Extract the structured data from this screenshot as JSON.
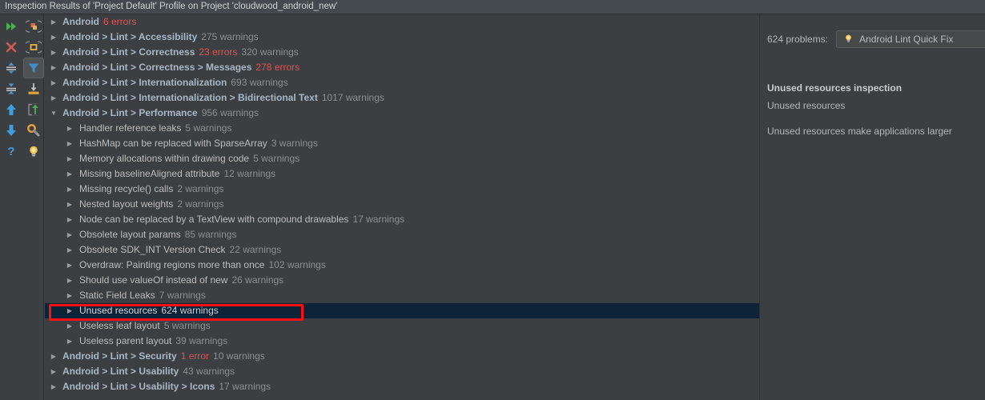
{
  "window": {
    "title": "Inspection Results of 'Project Default' Profile on Project 'cloudwood_android_new'"
  },
  "toolbar": {
    "left_column": [
      {
        "name": "rerun-inspection-icon",
        "label": "Rerun inspection"
      },
      {
        "name": "close-icon",
        "label": "Close"
      },
      {
        "name": "expand-all-icon",
        "label": "Expand all"
      },
      {
        "name": "collapse-all-icon",
        "label": "Collapse all"
      },
      {
        "name": "previous-problem-icon",
        "label": "Previous problem"
      },
      {
        "name": "next-problem-icon",
        "label": "Next problem"
      },
      {
        "name": "help-icon",
        "label": "Help"
      }
    ],
    "right_column": [
      {
        "name": "group-by-severity-icon",
        "label": "Group by severity"
      },
      {
        "name": "group-by-directory-icon",
        "label": "Group by directory"
      },
      {
        "name": "filter-icon",
        "label": "Filter resolved items",
        "active": true
      },
      {
        "name": "export-icon",
        "label": "Export"
      },
      {
        "name": "open-in-editor-icon",
        "label": "Open in editor"
      },
      {
        "name": "edit-settings-icon",
        "label": "Edit settings"
      },
      {
        "name": "quick-fix-bulb-icon",
        "label": "Quick fix"
      }
    ]
  },
  "tree": {
    "rows": [
      {
        "depth": 0,
        "expanded": false,
        "label": "Android",
        "counts": [
          {
            "text": "6 errors",
            "type": "error"
          }
        ]
      },
      {
        "depth": 0,
        "expanded": false,
        "label": "Android > Lint > Accessibility",
        "counts": [
          {
            "text": "275 warnings",
            "type": "warning"
          }
        ]
      },
      {
        "depth": 0,
        "expanded": false,
        "label": "Android > Lint > Correctness",
        "counts": [
          {
            "text": "23 errors",
            "type": "error"
          },
          {
            "text": "320 warnings",
            "type": "warning"
          }
        ]
      },
      {
        "depth": 0,
        "expanded": false,
        "label": "Android > Lint > Correctness > Messages",
        "counts": [
          {
            "text": "278 errors",
            "type": "error"
          }
        ]
      },
      {
        "depth": 0,
        "expanded": false,
        "label": "Android > Lint > Internationalization",
        "counts": [
          {
            "text": "693 warnings",
            "type": "warning"
          }
        ]
      },
      {
        "depth": 0,
        "expanded": false,
        "label": "Android > Lint > Internationalization > Bidirectional Text",
        "counts": [
          {
            "text": "1017 warnings",
            "type": "warning"
          }
        ]
      },
      {
        "depth": 0,
        "expanded": true,
        "label": "Android > Lint > Performance",
        "counts": [
          {
            "text": "956 warnings",
            "type": "warning"
          }
        ]
      },
      {
        "depth": 1,
        "expanded": false,
        "label": "Handler reference leaks",
        "counts": [
          {
            "text": "5 warnings",
            "type": "warning"
          }
        ]
      },
      {
        "depth": 1,
        "expanded": false,
        "label": "HashMap can be replaced with SparseArray",
        "counts": [
          {
            "text": "3 warnings",
            "type": "warning"
          }
        ]
      },
      {
        "depth": 1,
        "expanded": false,
        "label": "Memory allocations within drawing code",
        "counts": [
          {
            "text": "5 warnings",
            "type": "warning"
          }
        ]
      },
      {
        "depth": 1,
        "expanded": false,
        "label": "Missing baselineAligned attribute",
        "counts": [
          {
            "text": "12 warnings",
            "type": "warning"
          }
        ]
      },
      {
        "depth": 1,
        "expanded": false,
        "label": "Missing recycle() calls",
        "counts": [
          {
            "text": "2 warnings",
            "type": "warning"
          }
        ]
      },
      {
        "depth": 1,
        "expanded": false,
        "label": "Nested layout weights",
        "counts": [
          {
            "text": "2 warnings",
            "type": "warning"
          }
        ]
      },
      {
        "depth": 1,
        "expanded": false,
        "label": "Node can be replaced by a TextView with compound drawables",
        "counts": [
          {
            "text": "17 warnings",
            "type": "warning"
          }
        ]
      },
      {
        "depth": 1,
        "expanded": false,
        "label": "Obsolete layout params",
        "counts": [
          {
            "text": "85 warnings",
            "type": "warning"
          }
        ]
      },
      {
        "depth": 1,
        "expanded": false,
        "label": "Obsolete SDK_INT Version Check",
        "counts": [
          {
            "text": "22 warnings",
            "type": "warning"
          }
        ]
      },
      {
        "depth": 1,
        "expanded": false,
        "label": "Overdraw: Painting regions more than once",
        "counts": [
          {
            "text": "102 warnings",
            "type": "warning"
          }
        ]
      },
      {
        "depth": 1,
        "expanded": false,
        "label": "Should use valueOf instead of new",
        "counts": [
          {
            "text": "26 warnings",
            "type": "warning"
          }
        ]
      },
      {
        "depth": 1,
        "expanded": false,
        "label": "Static Field Leaks",
        "counts": [
          {
            "text": "7 warnings",
            "type": "warning"
          }
        ]
      },
      {
        "depth": 1,
        "expanded": false,
        "selected": true,
        "label": "Unused resources",
        "counts": [
          {
            "text": "624 warnings",
            "type": "warning"
          }
        ]
      },
      {
        "depth": 1,
        "expanded": false,
        "label": "Useless leaf layout",
        "counts": [
          {
            "text": "5 warnings",
            "type": "warning"
          }
        ]
      },
      {
        "depth": 1,
        "expanded": false,
        "label": "Useless parent layout",
        "counts": [
          {
            "text": "39 warnings",
            "type": "warning"
          }
        ]
      },
      {
        "depth": 0,
        "expanded": false,
        "label": "Android > Lint > Security",
        "counts": [
          {
            "text": "1 error",
            "type": "error"
          },
          {
            "text": "10 warnings",
            "type": "warning"
          }
        ]
      },
      {
        "depth": 0,
        "expanded": false,
        "label": "Android > Lint > Usability",
        "counts": [
          {
            "text": "43 warnings",
            "type": "warning"
          }
        ]
      },
      {
        "depth": 0,
        "expanded": false,
        "label": "Android > Lint > Usability > Icons",
        "counts": [
          {
            "text": "17 warnings",
            "type": "warning"
          }
        ]
      }
    ],
    "expanded_glyph": "▼",
    "collapsed_glyph": "▶"
  },
  "detail": {
    "problems_label": "624 problems:",
    "quickfix_label": "Android Lint Quick Fix",
    "title": "Unused resources inspection",
    "subtitle": "Unused resources",
    "body": "Unused resources make applications larger"
  },
  "colors": {
    "background": "#3c3f41",
    "titlebar": "#43494f",
    "selection": "#0d2338",
    "annotation": "#ff1010",
    "error_text": "#e05252",
    "label_text": "#a9b7c6",
    "count_text": "#8d8f91"
  }
}
